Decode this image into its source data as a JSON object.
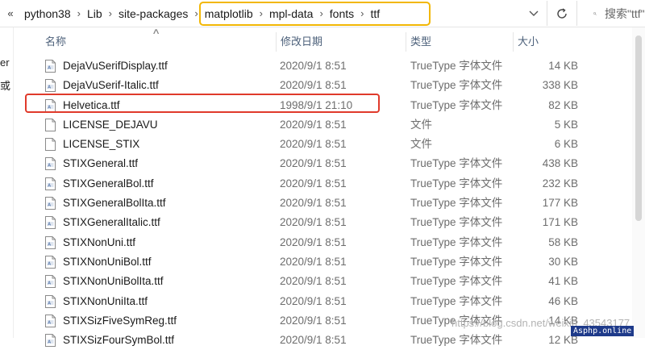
{
  "address_bar": {
    "overflow_glyph": "«",
    "crumbs": [
      "python38",
      "Lib",
      "site-packages",
      "matplotlib",
      "mpl-data",
      "fonts",
      "ttf"
    ],
    "search_placeholder": "搜索\"ttf\""
  },
  "nav_pane": {
    "fragments": [
      "er",
      "或"
    ]
  },
  "columns": {
    "name": "名称",
    "date": "修改日期",
    "type": "类型",
    "size": "大小"
  },
  "files": [
    {
      "name": "DejaVuSerifDisplay.ttf",
      "date": "2020/9/1 8:51",
      "type": "TrueType 字体文件",
      "size": "14 KB",
      "icon": "font-file-icon"
    },
    {
      "name": "DejaVuSerif-Italic.ttf",
      "date": "2020/9/1 8:51",
      "type": "TrueType 字体文件",
      "size": "338 KB",
      "icon": "font-file-icon"
    },
    {
      "name": "Helvetica.ttf",
      "date": "1998/9/1 21:10",
      "type": "TrueType 字体文件",
      "size": "82 KB",
      "icon": "font-file-icon"
    },
    {
      "name": "LICENSE_DEJAVU",
      "date": "2020/9/1 8:51",
      "type": "文件",
      "size": "5 KB",
      "icon": "blank-file-icon"
    },
    {
      "name": "LICENSE_STIX",
      "date": "2020/9/1 8:51",
      "type": "文件",
      "size": "6 KB",
      "icon": "blank-file-icon"
    },
    {
      "name": "STIXGeneral.ttf",
      "date": "2020/9/1 8:51",
      "type": "TrueType 字体文件",
      "size": "438 KB",
      "icon": "font-file-icon"
    },
    {
      "name": "STIXGeneralBol.ttf",
      "date": "2020/9/1 8:51",
      "type": "TrueType 字体文件",
      "size": "232 KB",
      "icon": "font-file-icon"
    },
    {
      "name": "STIXGeneralBolIta.ttf",
      "date": "2020/9/1 8:51",
      "type": "TrueType 字体文件",
      "size": "177 KB",
      "icon": "font-file-icon"
    },
    {
      "name": "STIXGeneralItalic.ttf",
      "date": "2020/9/1 8:51",
      "type": "TrueType 字体文件",
      "size": "171 KB",
      "icon": "font-file-icon"
    },
    {
      "name": "STIXNonUni.ttf",
      "date": "2020/9/1 8:51",
      "type": "TrueType 字体文件",
      "size": "58 KB",
      "icon": "font-file-icon"
    },
    {
      "name": "STIXNonUniBol.ttf",
      "date": "2020/9/1 8:51",
      "type": "TrueType 字体文件",
      "size": "30 KB",
      "icon": "font-file-icon"
    },
    {
      "name": "STIXNonUniBolIta.ttf",
      "date": "2020/9/1 8:51",
      "type": "TrueType 字体文件",
      "size": "41 KB",
      "icon": "font-file-icon"
    },
    {
      "name": "STIXNonUniIta.ttf",
      "date": "2020/9/1 8:51",
      "type": "TrueType 字体文件",
      "size": "46 KB",
      "icon": "font-file-icon"
    },
    {
      "name": "STIXSizFiveSymReg.ttf",
      "date": "2020/9/1 8:51",
      "type": "TrueType 字体文件",
      "size": "14 KB",
      "icon": "font-file-icon"
    },
    {
      "name": "STIXSizFourSymBol.ttf",
      "date": "2020/9/1 8:51",
      "type": "TrueType 字体文件",
      "size": "12 KB",
      "icon": "font-file-icon"
    }
  ],
  "watermark": {
    "text": "https://blog.csdn.net/weixin_43543177",
    "badge": "Asphp.online"
  },
  "colors": {
    "highlight_yellow": "#f2b705",
    "highlight_red": "#e03a2b",
    "header_text": "#4c607a"
  }
}
